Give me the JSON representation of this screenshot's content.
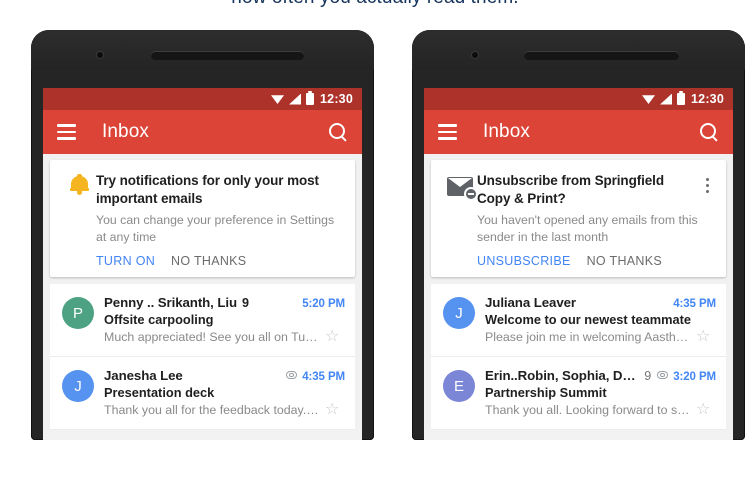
{
  "caption": "how often you actually read them.",
  "colors": {
    "statusbar": "#ad322a",
    "appbar": "#dc4437",
    "accent_blue": "#4285f4",
    "bell_yellow": "#f5b521",
    "avatar_green": "#4CA282",
    "avatar_blue": "#5692EF",
    "avatar_purple": "#7B86D6"
  },
  "phones": [
    {
      "statusbar": {
        "time": "12:30",
        "icons": [
          "wifi-icon",
          "signal-icon",
          "battery-icon"
        ]
      },
      "appbar": {
        "menu_icon": "hamburger-icon",
        "title": "Inbox",
        "search_icon": "search-icon"
      },
      "card": {
        "icon": "bell-icon",
        "title": "Try notifications for only your most important emails",
        "subtitle": "You can change your preference in Settings at any time",
        "primary_action": "TURN ON",
        "secondary_action": "NO THANKS",
        "has_overflow": false
      },
      "mails": [
        {
          "avatar_letter": "P",
          "avatar_color": "#4CA282",
          "sender": "Penny .. Srikanth, Liu",
          "count": "9",
          "count_bold": true,
          "attachment": false,
          "time": "5:20 PM",
          "subject": "Offsite carpooling",
          "snippet": "Much appreciated! See you all on Tue..."
        },
        {
          "avatar_letter": "J",
          "avatar_color": "#5692EF",
          "sender": "Janesha Lee",
          "count": "",
          "count_bold": false,
          "attachment": true,
          "time": "4:35 PM",
          "subject": "Presentation deck",
          "snippet": "Thank you all for the feedback today. ..."
        }
      ]
    },
    {
      "statusbar": {
        "time": "12:30",
        "icons": [
          "wifi-icon",
          "signal-icon",
          "battery-icon"
        ]
      },
      "appbar": {
        "menu_icon": "hamburger-icon",
        "title": "Inbox",
        "search_icon": "search-icon"
      },
      "card": {
        "icon": "envelope-unsubscribe-icon",
        "title": "Unsubscribe from Springfield Copy & Print?",
        "subtitle": "You haven't opened any emails from this sender in the last month",
        "primary_action": "UNSUBSCRIBE",
        "secondary_action": "NO THANKS",
        "has_overflow": true
      },
      "mails": [
        {
          "avatar_letter": "J",
          "avatar_color": "#5692EF",
          "sender": "Juliana Leaver",
          "count": "",
          "count_bold": false,
          "attachment": false,
          "time": "4:35 PM",
          "subject": "Welcome to our newest teammate",
          "snippet": "Please join me in welcoming Aastha ..."
        },
        {
          "avatar_letter": "E",
          "avatar_color": "#7B86D6",
          "sender": "Erin..Robin, Sophia, Dave",
          "count": "9",
          "count_bold": false,
          "attachment": true,
          "time": "3:20 PM",
          "subject": "Partnership Summit",
          "snippet": "Thank you all. Looking forward to see..."
        }
      ]
    }
  ]
}
